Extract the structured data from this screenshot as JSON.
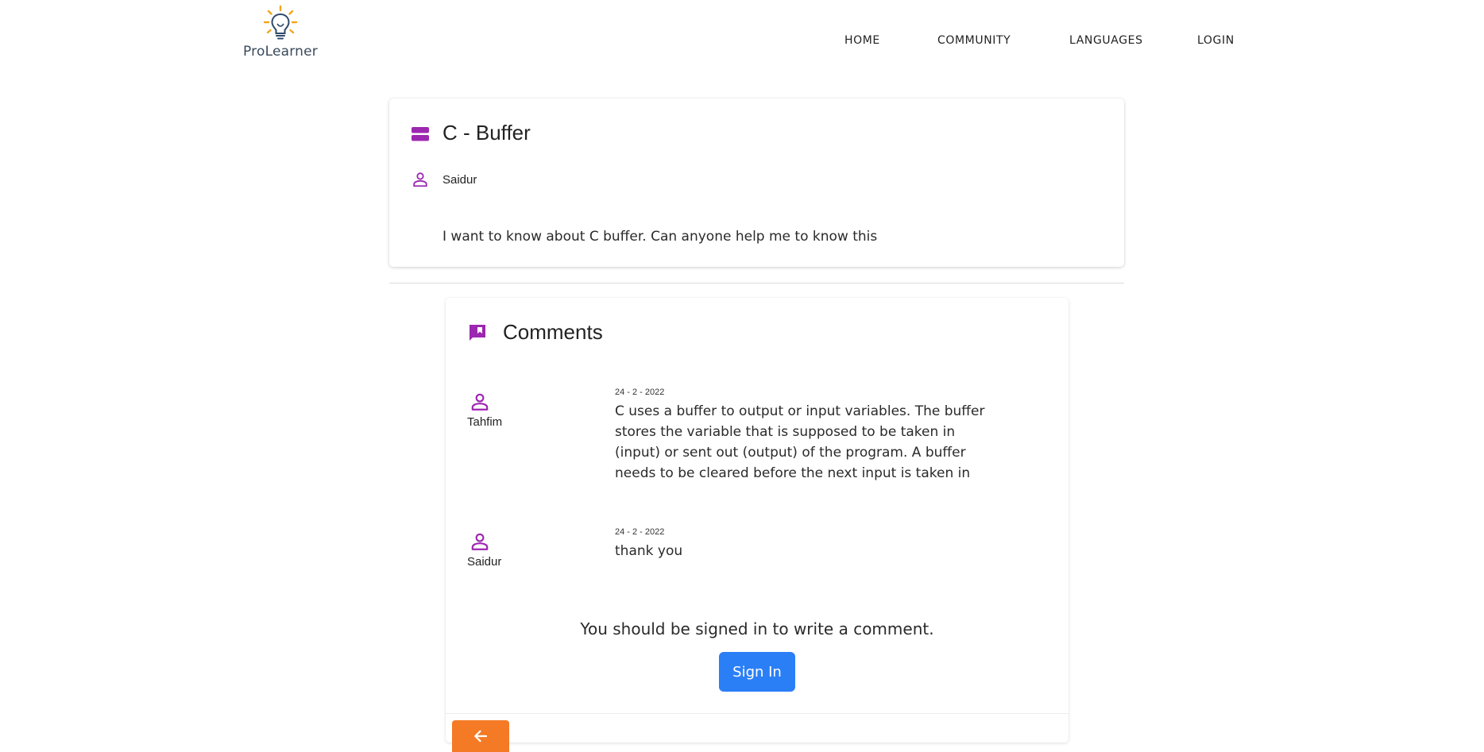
{
  "colors": {
    "accent_purple": "#9c27b0",
    "signin_blue": "#2b7ff6",
    "back_orange": "#f47a25",
    "logo_yellow": "#f2a51a"
  },
  "logo": {
    "text": "ProLearner",
    "icon": "lightbulb-icon"
  },
  "nav": {
    "home": "HOME",
    "community": "COMMUNITY",
    "languages": "LANGUAGES",
    "login": "LOGIN"
  },
  "post": {
    "title": "C - Buffer",
    "title_icon": "storage-icon",
    "author": "Saidur",
    "author_icon": "person-icon",
    "body": "I want to know about C buffer. Can anyone help me to know this"
  },
  "comments": {
    "heading": "Comments",
    "heading_icon": "comment-bookmark-icon",
    "items": [
      {
        "user": "Tahfim",
        "date": "24 - 2 - 2022",
        "text": "C uses a buffer to output or input variables. The buffer stores the variable that is supposed to be taken in (input) or sent out (output) of the program. A buffer needs to be cleared before the next input is taken in"
      },
      {
        "user": "Saidur",
        "date": "24 - 2 - 2022",
        "text": "thank you"
      }
    ],
    "signin_message": "You should be signed in to write a comment.",
    "signin_button": "Sign In"
  },
  "back_button": {
    "icon": "arrow-left-icon"
  }
}
